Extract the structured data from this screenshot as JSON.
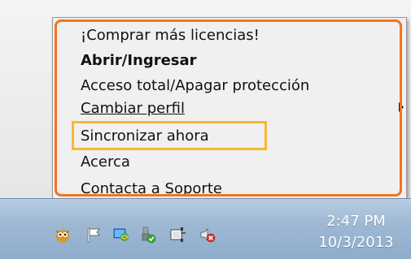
{
  "context_menu": {
    "items": [
      {
        "label": "¡Comprar más licencias!"
      },
      {
        "label": "Abrir/Ingresar"
      },
      {
        "label": "Acceso total/Apagar protección"
      },
      {
        "label": "Cambiar perfil"
      },
      {
        "label": "Sincronizar ahora"
      },
      {
        "label": "Acerca"
      },
      {
        "label": "Contacta a Soporte"
      }
    ],
    "highlight_colors": {
      "menu": "#f4731f",
      "selected_item": "#f7b733"
    }
  },
  "taskbar": {
    "tray_icons": [
      {
        "name": "owl-app-icon"
      },
      {
        "name": "flag-icon"
      },
      {
        "name": "network-globe-icon"
      },
      {
        "name": "usb-device-icon"
      },
      {
        "name": "power-plug-icon"
      },
      {
        "name": "speaker-muted-icon"
      }
    ],
    "clock": {
      "time": "2:47 PM",
      "date": "10/3/2013"
    }
  }
}
